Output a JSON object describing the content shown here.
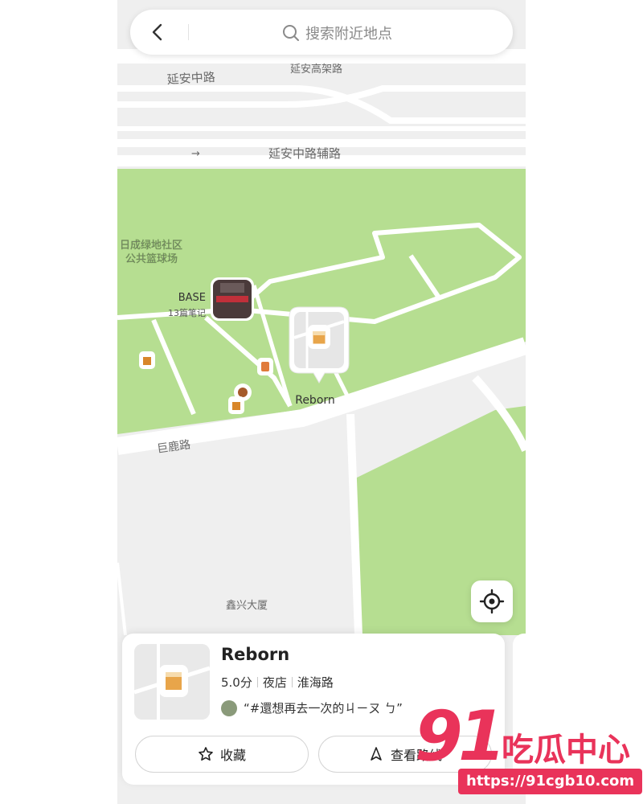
{
  "search": {
    "placeholder": "搜索附近地点"
  },
  "map": {
    "road_labels": {
      "yanan_zhong_lu": "延安中路",
      "yanan_gaojia_lu": "延安高架路",
      "yanan_fudao": "延安中路辅路",
      "julu_lu": "巨鹿路"
    },
    "area_labels": {
      "park_court_line1": "日成绿地社区",
      "park_court_line2": "公共篮球场",
      "building": "鑫兴大厦"
    },
    "pois": {
      "base": {
        "name": "BASE",
        "notes": "13篇笔记"
      },
      "reborn": {
        "name": "Reborn"
      }
    },
    "colors": {
      "park": "#b6de91",
      "road": "#ffffff",
      "land": "#efefef"
    }
  },
  "card": {
    "title": "Reborn",
    "rating": "5.0分",
    "category": "夜店",
    "area": "淮海路",
    "review": "“#還想再去一次的ㄐㄧㄡ ㄅ”",
    "favorite_label": "收藏",
    "route_label": "查看路线"
  },
  "watermark": {
    "number": "91",
    "text": "吃瓜中心",
    "url": "https://91cgb10.com"
  },
  "icons": {
    "back": "chevron-left-icon",
    "search": "search-icon",
    "locate": "locate-icon",
    "favorite": "star-icon",
    "route": "navigation-icon"
  },
  "accent_color": "#e9335a"
}
